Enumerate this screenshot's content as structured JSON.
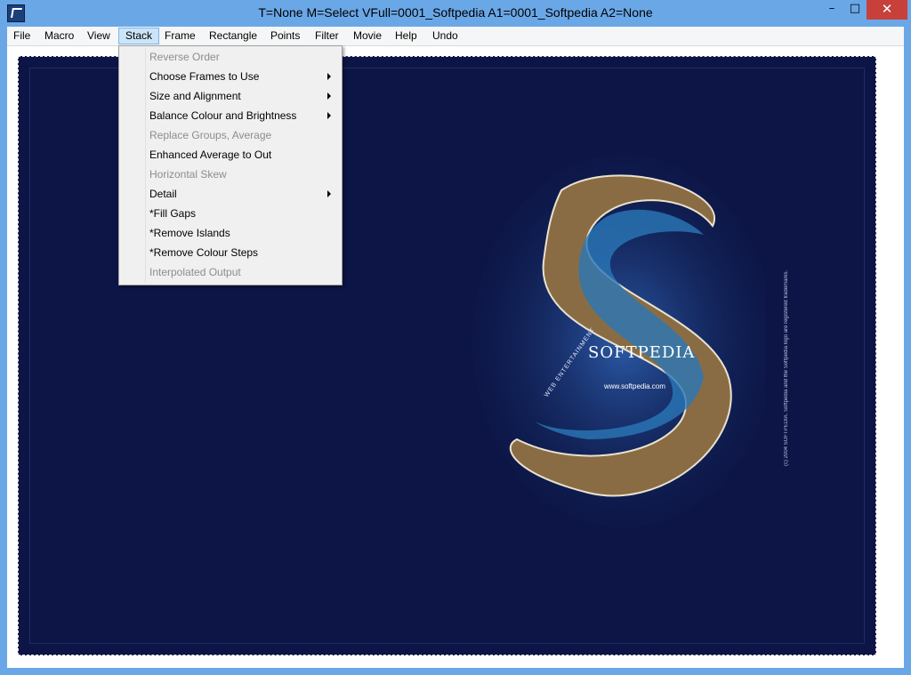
{
  "window": {
    "title": "T=None M=Select VFull=0001_Softpedia  A1=0001_Softpedia  A2=None"
  },
  "window_buttons": {
    "minimize": "–",
    "maximize": "□",
    "close": "✕"
  },
  "menu": [
    "File",
    "Macro",
    "View",
    "Stack",
    "Frame",
    "Rectangle",
    "Points",
    "Filter",
    "Movie",
    "Help",
    "Undo"
  ],
  "stack_menu": [
    {
      "label": "Reverse Order",
      "disabled": true,
      "submenu": false
    },
    {
      "label": "Choose Frames to Use",
      "disabled": false,
      "submenu": true
    },
    {
      "label": "Size and Alignment",
      "disabled": false,
      "submenu": true
    },
    {
      "label": "Balance Colour and Brightness",
      "disabled": false,
      "submenu": true
    },
    {
      "label": "Replace Groups, Average",
      "disabled": true,
      "submenu": false
    },
    {
      "label": "Enhanced Average to Out",
      "disabled": false,
      "submenu": false
    },
    {
      "label": "Horizontal Skew",
      "disabled": true,
      "submenu": false
    },
    {
      "label": "Detail",
      "disabled": false,
      "submenu": true
    },
    {
      "label": "*Fill Gaps",
      "disabled": false,
      "submenu": false
    },
    {
      "label": "*Remove Islands",
      "disabled": false,
      "submenu": false
    },
    {
      "label": "*Remove Colour Steps",
      "disabled": false,
      "submenu": false
    },
    {
      "label": "Interpolated Output",
      "disabled": true,
      "submenu": false
    }
  ],
  "image": {
    "brand": "SOFTPEDIA",
    "url": "www.softpedia.com",
    "tagline": "WEB ENTERTAINMENT",
    "side_text": "(c) 2004 SOFTPEDIA. Softpedia and the Softpedia logo are registered trademarks."
  },
  "colors": {
    "title_bg": "#6aa7e6",
    "close_bg": "#c7403a",
    "image_bg": "#0c1545",
    "menu_active": "#cce4f7"
  }
}
